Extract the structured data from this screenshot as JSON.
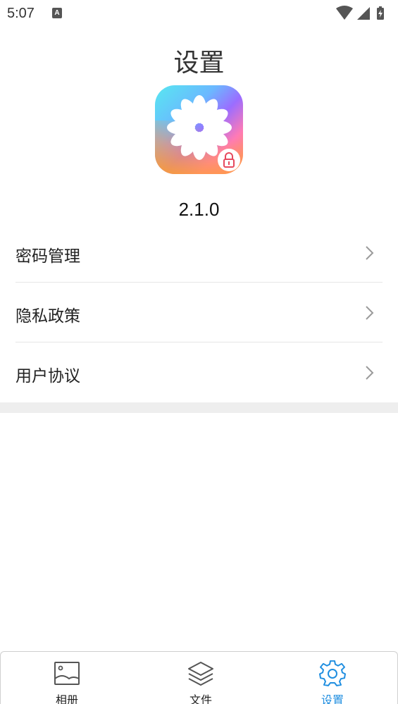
{
  "status": {
    "time": "5:07",
    "notification_glyph": "A"
  },
  "header": {
    "title": "设置"
  },
  "app": {
    "version": "2.1.0"
  },
  "menu": {
    "items": [
      {
        "label": "密码管理",
        "icon": "chevron-right-icon"
      },
      {
        "label": "隐私政策",
        "icon": "chevron-right-icon"
      },
      {
        "label": "用户协议",
        "icon": "chevron-right-icon"
      }
    ]
  },
  "tabs": [
    {
      "label": "相册",
      "icon": "image-icon",
      "active": false
    },
    {
      "label": "文件",
      "icon": "layers-icon",
      "active": false
    },
    {
      "label": "设置",
      "icon": "gear-icon",
      "active": true
    }
  ],
  "colors": {
    "accent": "#1f8ee0",
    "divider": "#e6e6e6",
    "band": "#eeeeee",
    "lock": "#e64a5e"
  }
}
